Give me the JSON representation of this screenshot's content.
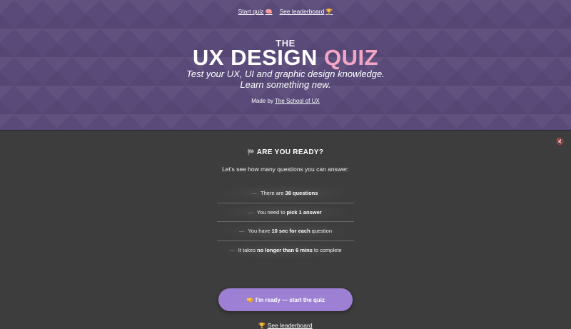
{
  "nav": {
    "start_label": "Start quiz",
    "start_icon": "🧠",
    "leaderboard_label": "See leaderboard",
    "leaderboard_icon": "🏆"
  },
  "hero": {
    "kicker": "THE",
    "title_main": "UX DESIGN",
    "title_accent": "QUIZ",
    "subtitle_line1": "Test your UX, UI and graphic design knowledge.",
    "subtitle_line2": "Learn something new.",
    "made_by_prefix": "Made by",
    "made_by_link": "The School of UX"
  },
  "sound": {
    "icon": "🔇"
  },
  "ready": {
    "heading_icon": "🏁",
    "heading": "ARE YOU READY?",
    "intro": "Let's see how many questions you can answer:",
    "rules": [
      {
        "pre": "There are",
        "bold": "38 questions",
        "post": ""
      },
      {
        "pre": "You need to",
        "bold": "pick 1 answer",
        "post": ""
      },
      {
        "pre": "You have",
        "bold": "10 sec for each",
        "post": "question"
      },
      {
        "pre": "It takes",
        "bold": "no longer than 6 mins",
        "post": "to complete"
      }
    ],
    "dash": "—"
  },
  "cta": {
    "icon": "🤜",
    "label": "I'm ready — start the quiz"
  },
  "footer": {
    "leaderboard_icon": "🏆",
    "leaderboard_label": "See leaderboard"
  },
  "colors": {
    "hero_bg": "#5a4a7a",
    "page_bg": "#3d3d3d",
    "accent_pink": "#f3a6c4",
    "cta_purple": "#9d80d4"
  }
}
